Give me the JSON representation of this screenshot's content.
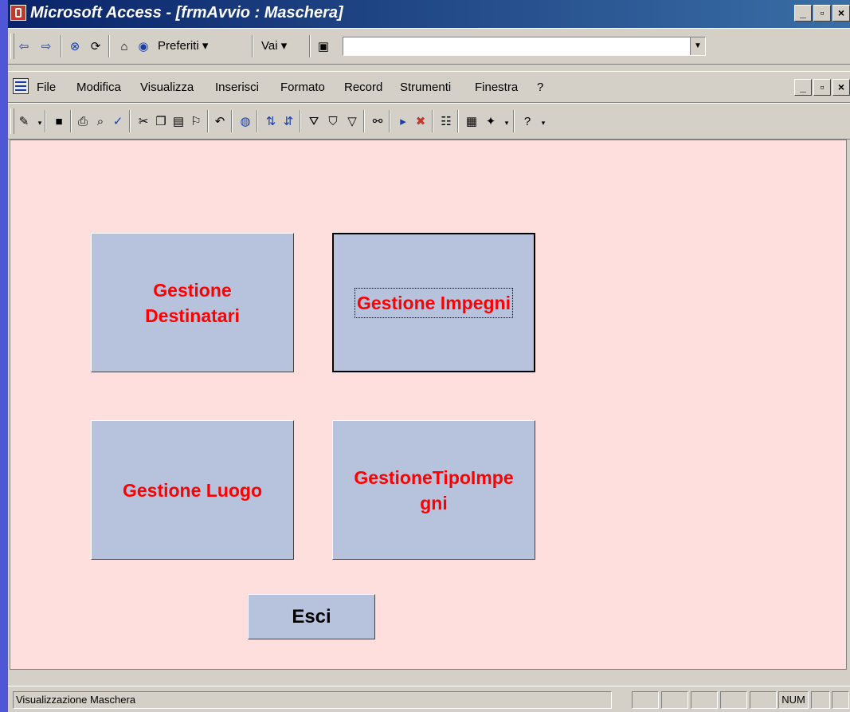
{
  "window": {
    "title": "Microsoft Access - [frmAvvio : Maschera]",
    "controls": [
      "_",
      "▫",
      "×"
    ]
  },
  "web_toolbar": {
    "back_icon": "back-arrow-icon",
    "forward_icon": "forward-arrow-icon",
    "stop_icon": "stop-icon",
    "refresh_icon": "refresh-icon",
    "home_icon": "home-icon",
    "search_icon": "globe-search-icon",
    "favorites_label": "Preferiti ▾",
    "go_label": "Vai ▾",
    "address_value": ""
  },
  "menubar": {
    "items": [
      "File",
      "Modifica",
      "Visualizza",
      "Inserisci",
      "Formato",
      "Record",
      "Strumenti",
      "Finestra",
      "?"
    ],
    "controls": [
      "_",
      "▫",
      "×"
    ]
  },
  "form": {
    "buttons": {
      "destinatari": "Gestione Destinatari",
      "impegni": "Gestione Impegni",
      "luogo": "Gestione Luogo",
      "tipo_impegni": "GestioneTipoImpe gni",
      "esci": "Esci"
    },
    "colors": {
      "background": "#ffdede",
      "button_face": "#b7c3dc",
      "button_text": "#ff0000"
    }
  },
  "statusbar": {
    "text": "Visualizzazione Maschera",
    "num": "NUM"
  }
}
